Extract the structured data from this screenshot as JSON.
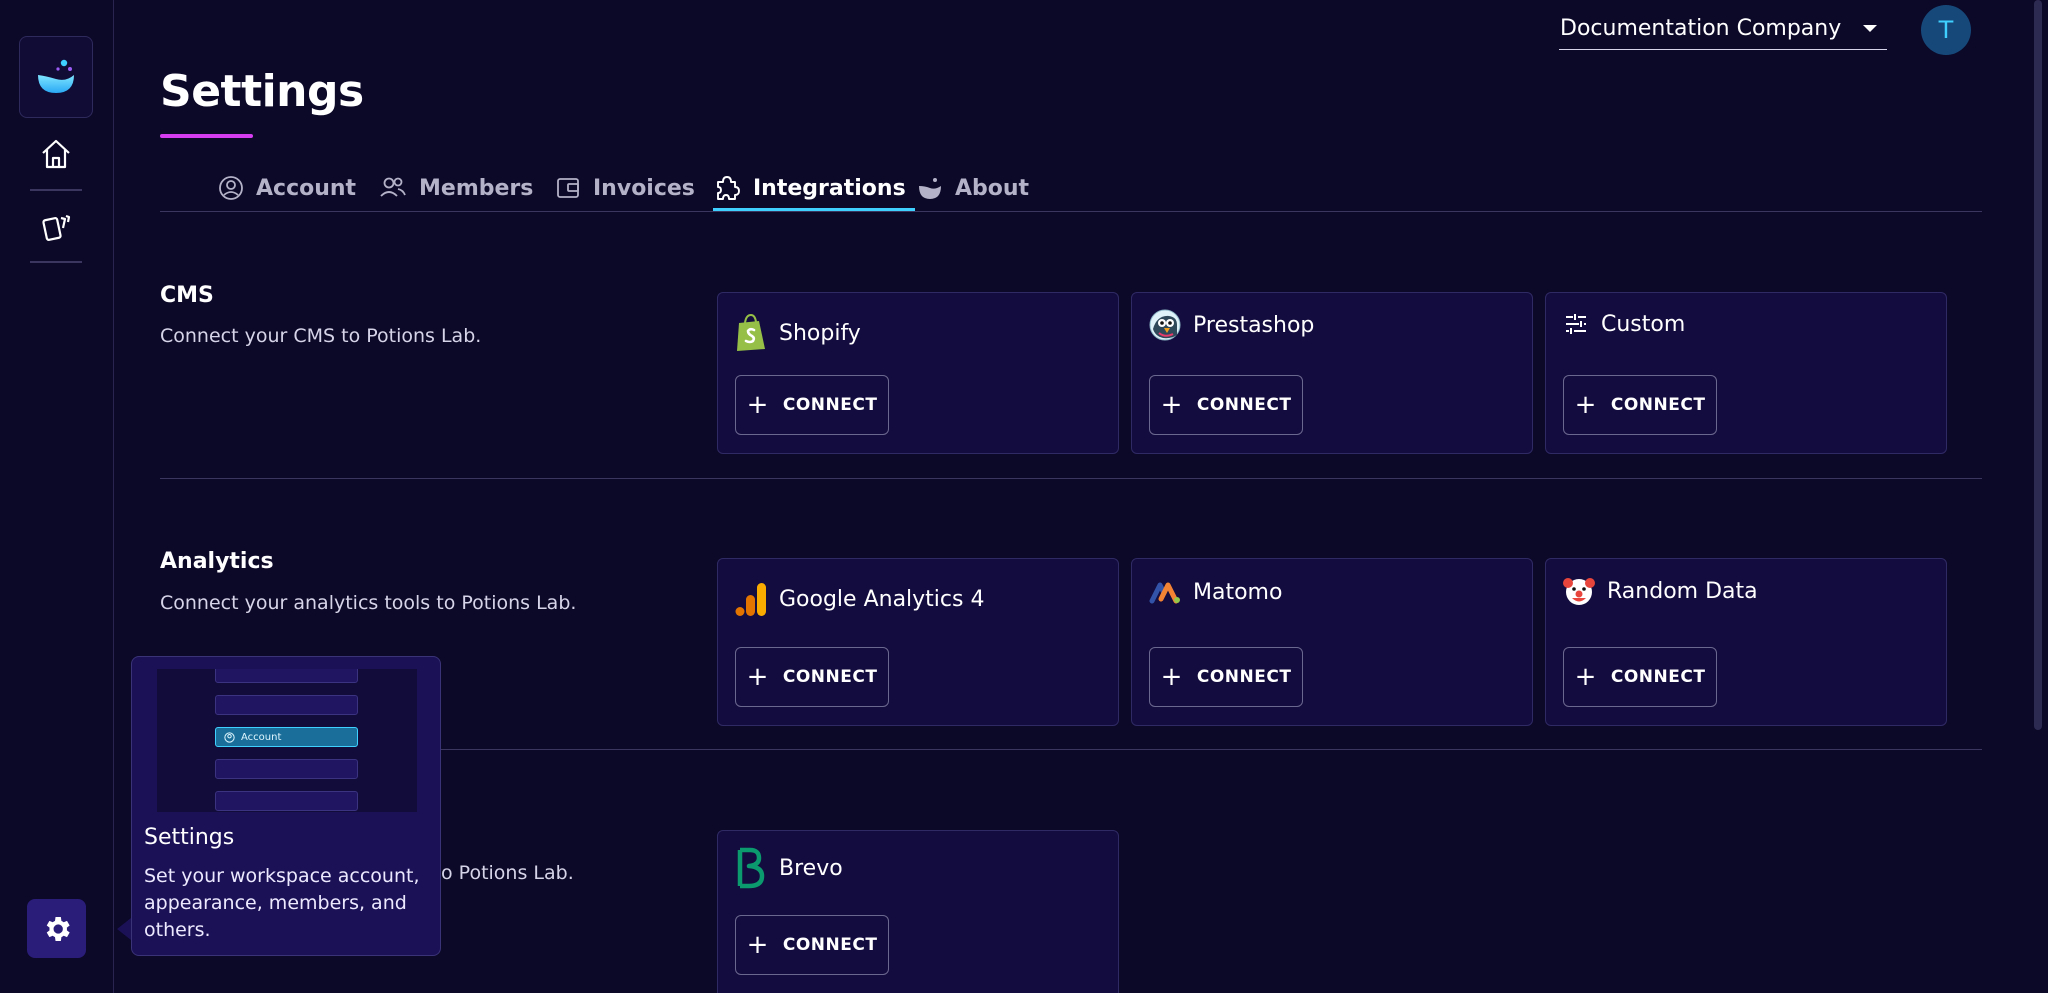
{
  "header": {
    "company": "Documentation Company",
    "avatar_initial": "T"
  },
  "page": {
    "title": "Settings"
  },
  "tabs": [
    {
      "label": "Account",
      "icon": "user-circle-icon"
    },
    {
      "label": "Members",
      "icon": "users-icon"
    },
    {
      "label": "Invoices",
      "icon": "wallet-icon"
    },
    {
      "label": "Integrations",
      "icon": "puzzle-icon",
      "active": true
    },
    {
      "label": "About",
      "icon": "potion-bowl-icon"
    }
  ],
  "sections": {
    "cms": {
      "title": "CMS",
      "description": "Connect your CMS to Potions Lab.",
      "cards": [
        {
          "name": "Shopify",
          "icon": "shopify-icon",
          "button": "CONNECT"
        },
        {
          "name": "Prestashop",
          "icon": "prestashop-icon",
          "button": "CONNECT"
        },
        {
          "name": "Custom",
          "icon": "sliders-icon",
          "button": "CONNECT"
        }
      ]
    },
    "analytics": {
      "title": "Analytics",
      "description": "Connect your analytics tools to Potions Lab.",
      "cards": [
        {
          "name": "Google Analytics 4",
          "icon": "google-analytics-icon",
          "button": "CONNECT"
        },
        {
          "name": "Matomo",
          "icon": "matomo-icon",
          "button": "CONNECT"
        },
        {
          "name": "Random Data",
          "icon": "clown-icon",
          "button": "CONNECT"
        }
      ]
    },
    "emailing": {
      "description_visible": "o Potions Lab.",
      "cards": [
        {
          "name": "Brevo",
          "icon": "brevo-icon",
          "button": "CONNECT"
        }
      ]
    }
  },
  "tooltip": {
    "title": "Settings",
    "description": "Set your workspace account, appearance, members, and others.",
    "preview_label": "Account"
  },
  "colors": {
    "background": "#0c0828",
    "card": "#130c3e",
    "accent_cyan": "#3fd0ff",
    "accent_magenta": "#d63cf0",
    "gear_button": "#2a1d7a"
  }
}
